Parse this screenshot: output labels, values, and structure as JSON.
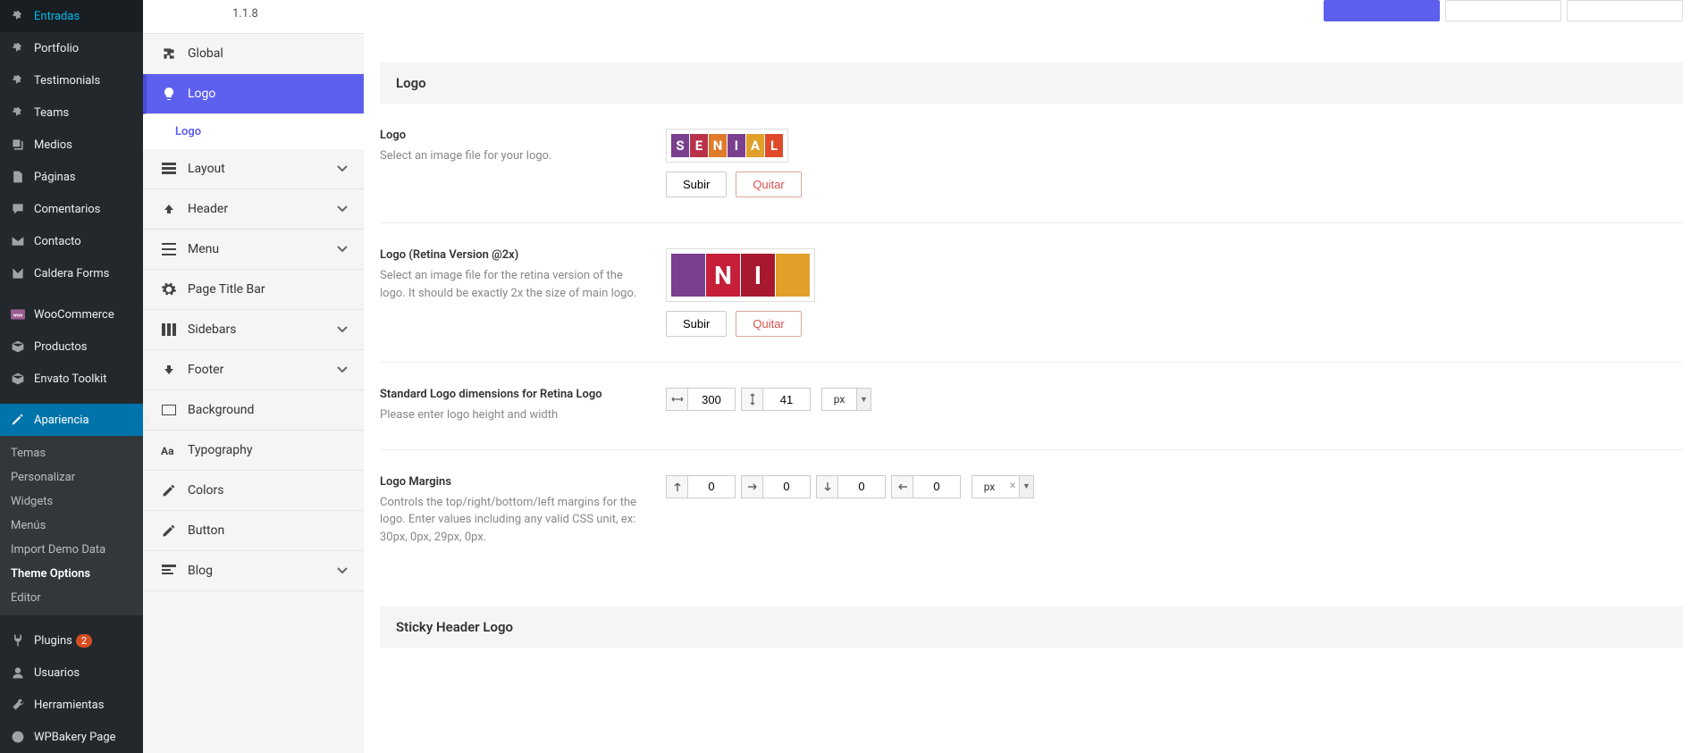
{
  "wp_menu": {
    "items": [
      {
        "label": "Entradas",
        "icon": "pin"
      },
      {
        "label": "Portfolio",
        "icon": "pin"
      },
      {
        "label": "Testimonials",
        "icon": "pin"
      },
      {
        "label": "Teams",
        "icon": "pin"
      },
      {
        "label": "Medios",
        "icon": "media"
      },
      {
        "label": "Páginas",
        "icon": "pages"
      },
      {
        "label": "Comentarios",
        "icon": "comments"
      },
      {
        "label": "Contacto",
        "icon": "mail"
      },
      {
        "label": "Caldera Forms",
        "icon": "form"
      }
    ],
    "items2": [
      {
        "label": "WooCommerce",
        "icon": "woo"
      },
      {
        "label": "Productos",
        "icon": "box"
      },
      {
        "label": "Envato Toolkit",
        "icon": "box"
      }
    ],
    "appearance": {
      "label": "Apariencia",
      "sub": [
        "Temas",
        "Personalizar",
        "Widgets",
        "Menús",
        "Import Demo Data",
        "Theme Options",
        "Editor"
      ],
      "active_sub": "Theme Options"
    },
    "items3": [
      {
        "label": "Plugins",
        "icon": "plugin",
        "badge": "2"
      },
      {
        "label": "Usuarios",
        "icon": "user"
      },
      {
        "label": "Herramientas",
        "icon": "tools"
      },
      {
        "label": "WPBakery Page",
        "icon": "wpb"
      }
    ]
  },
  "theme_menu": {
    "version": "1.1.8",
    "items": [
      {
        "label": "Global",
        "icon": "puzzle",
        "expandable": false
      },
      {
        "label": "Logo",
        "icon": "bulb",
        "expandable": false,
        "active": true,
        "sub": [
          "Logo"
        ]
      },
      {
        "label": "Layout",
        "icon": "layout",
        "expandable": true
      },
      {
        "label": "Header",
        "icon": "up",
        "expandable": true
      },
      {
        "label": "Menu",
        "icon": "menu",
        "expandable": true
      },
      {
        "label": "Page Title Bar",
        "icon": "gear",
        "expandable": false
      },
      {
        "label": "Sidebars",
        "icon": "sidebars",
        "expandable": true
      },
      {
        "label": "Footer",
        "icon": "down",
        "expandable": true
      },
      {
        "label": "Background",
        "icon": "bg",
        "expandable": false
      },
      {
        "label": "Typography",
        "icon": "typo",
        "expandable": false
      },
      {
        "label": "Colors",
        "icon": "pencil",
        "expandable": false
      },
      {
        "label": "Button",
        "icon": "pencil",
        "expandable": false
      },
      {
        "label": "Blog",
        "icon": "blog",
        "expandable": true
      }
    ]
  },
  "content": {
    "section1": "Logo",
    "logo": {
      "title": "Logo",
      "desc": "Select an image file for your logo.",
      "tiles": [
        {
          "c": "#7a3f8f",
          "l": "S"
        },
        {
          "c": "#b8324a",
          "l": "E"
        },
        {
          "c": "#e07b2a",
          "l": "N"
        },
        {
          "c": "#7a3f8f",
          "l": "I"
        },
        {
          "c": "#e0a02a",
          "l": "A"
        },
        {
          "c": "#e04a2a",
          "l": "L"
        }
      ],
      "upload": "Subir",
      "remove": "Quitar"
    },
    "logo_retina": {
      "title": "Logo (Retina Version @2x)",
      "desc": "Select an image file for the retina version of the logo. It should be exactly 2x the size of main logo.",
      "tiles": [
        {
          "c": "#7a3f8f",
          "l": ""
        },
        {
          "c": "#c61f3a",
          "l": "N"
        },
        {
          "c": "#a8182f",
          "l": "I"
        },
        {
          "c": "#e0a02a",
          "l": ""
        }
      ],
      "upload": "Subir",
      "remove": "Quitar"
    },
    "dimensions": {
      "title": "Standard Logo dimensions for Retina Logo",
      "desc": "Please enter logo height and width",
      "width": "300",
      "height": "41",
      "unit": "px"
    },
    "margins": {
      "title": "Logo Margins",
      "desc": "Controls the top/right/bottom/left margins for the logo. Enter values including any valid CSS unit, ex: 30px, 0px, 29px, 0px.",
      "top": "0",
      "right": "0",
      "bottom": "0",
      "left": "0",
      "unit": "px"
    },
    "section2": "Sticky Header Logo"
  }
}
